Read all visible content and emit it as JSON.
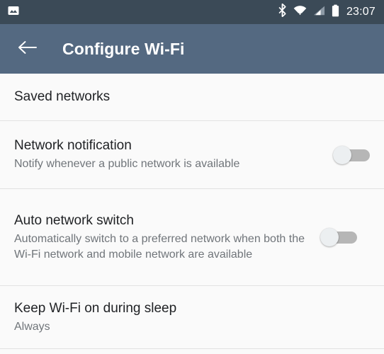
{
  "status_bar": {
    "notification_icon": "image-icon",
    "icons": [
      "bluetooth-icon",
      "wifi-icon",
      "cellular-signal-icon",
      "battery-icon"
    ],
    "time": "23:07",
    "background_color": "#3b4a57",
    "foreground_color": "#ffffff"
  },
  "app_bar": {
    "back_icon": "back-arrow-icon",
    "title": "Configure Wi-Fi",
    "background_color": "#546981",
    "title_color": "#ffffff"
  },
  "settings": {
    "items": [
      {
        "title": "Saved networks",
        "subtitle": "",
        "type": "link"
      },
      {
        "title": "Network notification",
        "subtitle": "Notify whenever a public network is available",
        "type": "switch",
        "switch_state": "off"
      },
      {
        "title": "Auto network switch",
        "subtitle": "Automatically switch to a preferred network when both the Wi-Fi network and mobile network are available",
        "type": "switch",
        "switch_state": "off"
      },
      {
        "title": "Keep Wi-Fi on during sleep",
        "subtitle": "Always",
        "type": "value"
      }
    ],
    "background_color": "#fafafa",
    "divider_color": "#e2e2e2",
    "title_color": "#1f2124",
    "subtitle_color": "#70757a"
  }
}
